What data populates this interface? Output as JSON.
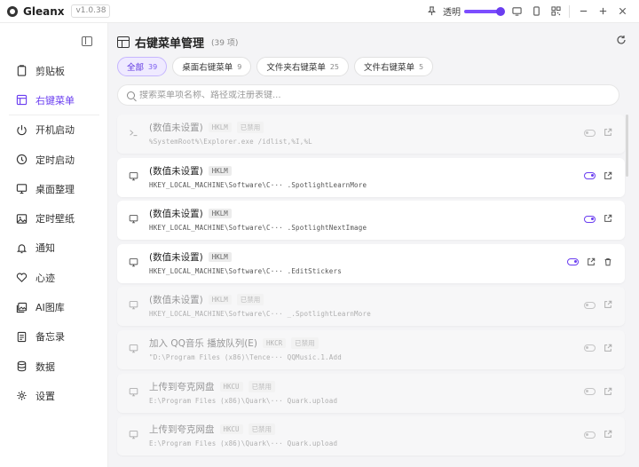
{
  "app": {
    "name": "Gleanx",
    "version": "v1.0.38"
  },
  "titlebar": {
    "opacity_label": "透明"
  },
  "sidebar": {
    "items": [
      {
        "label": "剪贴板",
        "icon": "clipboard-icon"
      },
      {
        "label": "右键菜单",
        "icon": "context-menu-icon",
        "active": true
      },
      {
        "label": "开机启动",
        "icon": "power-icon"
      },
      {
        "label": "定时启动",
        "icon": "clock-icon"
      },
      {
        "label": "桌面整理",
        "icon": "monitor-icon"
      },
      {
        "label": "定时壁纸",
        "icon": "image-icon"
      },
      {
        "label": "通知",
        "icon": "bell-icon"
      },
      {
        "label": "心迹",
        "icon": "heart-icon"
      },
      {
        "label": "AI图库",
        "icon": "gallery-icon"
      },
      {
        "label": "备忘录",
        "icon": "memo-icon"
      },
      {
        "label": "数据",
        "icon": "database-icon"
      },
      {
        "label": "设置",
        "icon": "gear-icon"
      }
    ]
  },
  "header": {
    "title": "右键菜单管理",
    "count": "(39 项)"
  },
  "tabs": [
    {
      "label": "全部",
      "count": "39",
      "active": true
    },
    {
      "label": "桌面右键菜单",
      "count": "9"
    },
    {
      "label": "文件夹右键菜单",
      "count": "25"
    },
    {
      "label": "文件右键菜单",
      "count": "5"
    }
  ],
  "search": {
    "placeholder": "搜索菜单项名称、路径或注册表键..."
  },
  "items": [
    {
      "name": "(数值未设置)",
      "hive": "HKLM",
      "status": "已禁用",
      "path": "%SystemRoot%\\Explorer.exe /idlist,%I,%L",
      "icon": "terminal-icon",
      "enabled": false,
      "deletable": false
    },
    {
      "name": "(数值未设置)",
      "hive": "HKLM",
      "status": "",
      "path": "HKEY_LOCAL_MACHINE\\Software\\C··· .SpotlightLearnMore",
      "icon": "monitor-icon",
      "enabled": true,
      "deletable": false
    },
    {
      "name": "(数值未设置)",
      "hive": "HKLM",
      "status": "",
      "path": "HKEY_LOCAL_MACHINE\\Software\\C··· .SpotlightNextImage",
      "icon": "monitor-icon",
      "enabled": true,
      "deletable": false
    },
    {
      "name": "(数值未设置)",
      "hive": "HKLM",
      "status": "",
      "path": "HKEY_LOCAL_MACHINE\\Software\\C··· .EditStickers",
      "icon": "monitor-icon",
      "enabled": true,
      "deletable": true
    },
    {
      "name": "(数值未设置)",
      "hive": "HKLM",
      "status": "已禁用",
      "path": "HKEY_LOCAL_MACHINE\\Software\\C··· _.SpotlightLearnMore",
      "icon": "monitor-icon",
      "enabled": false,
      "deletable": false
    },
    {
      "name": "加入 QQ音乐 播放队列(E)",
      "hive": "HKCR",
      "status": "已禁用",
      "path": "\"D:\\Program Files (x86)\\Tence··· QQMusic.1.Add",
      "icon": "monitor-icon",
      "enabled": false,
      "deletable": false
    },
    {
      "name": "上传到夸克网盘",
      "hive": "HKCU",
      "status": "已禁用",
      "path": "E:\\Program Files (x86)\\Quark\\··· Quark.upload",
      "icon": "monitor-icon",
      "enabled": false,
      "deletable": false
    },
    {
      "name": "上传到夸克网盘",
      "hive": "HKCU",
      "status": "已禁用",
      "path": "E:\\Program Files (x86)\\Quark\\··· Quark.upload",
      "icon": "monitor-icon",
      "enabled": false,
      "deletable": false
    }
  ]
}
